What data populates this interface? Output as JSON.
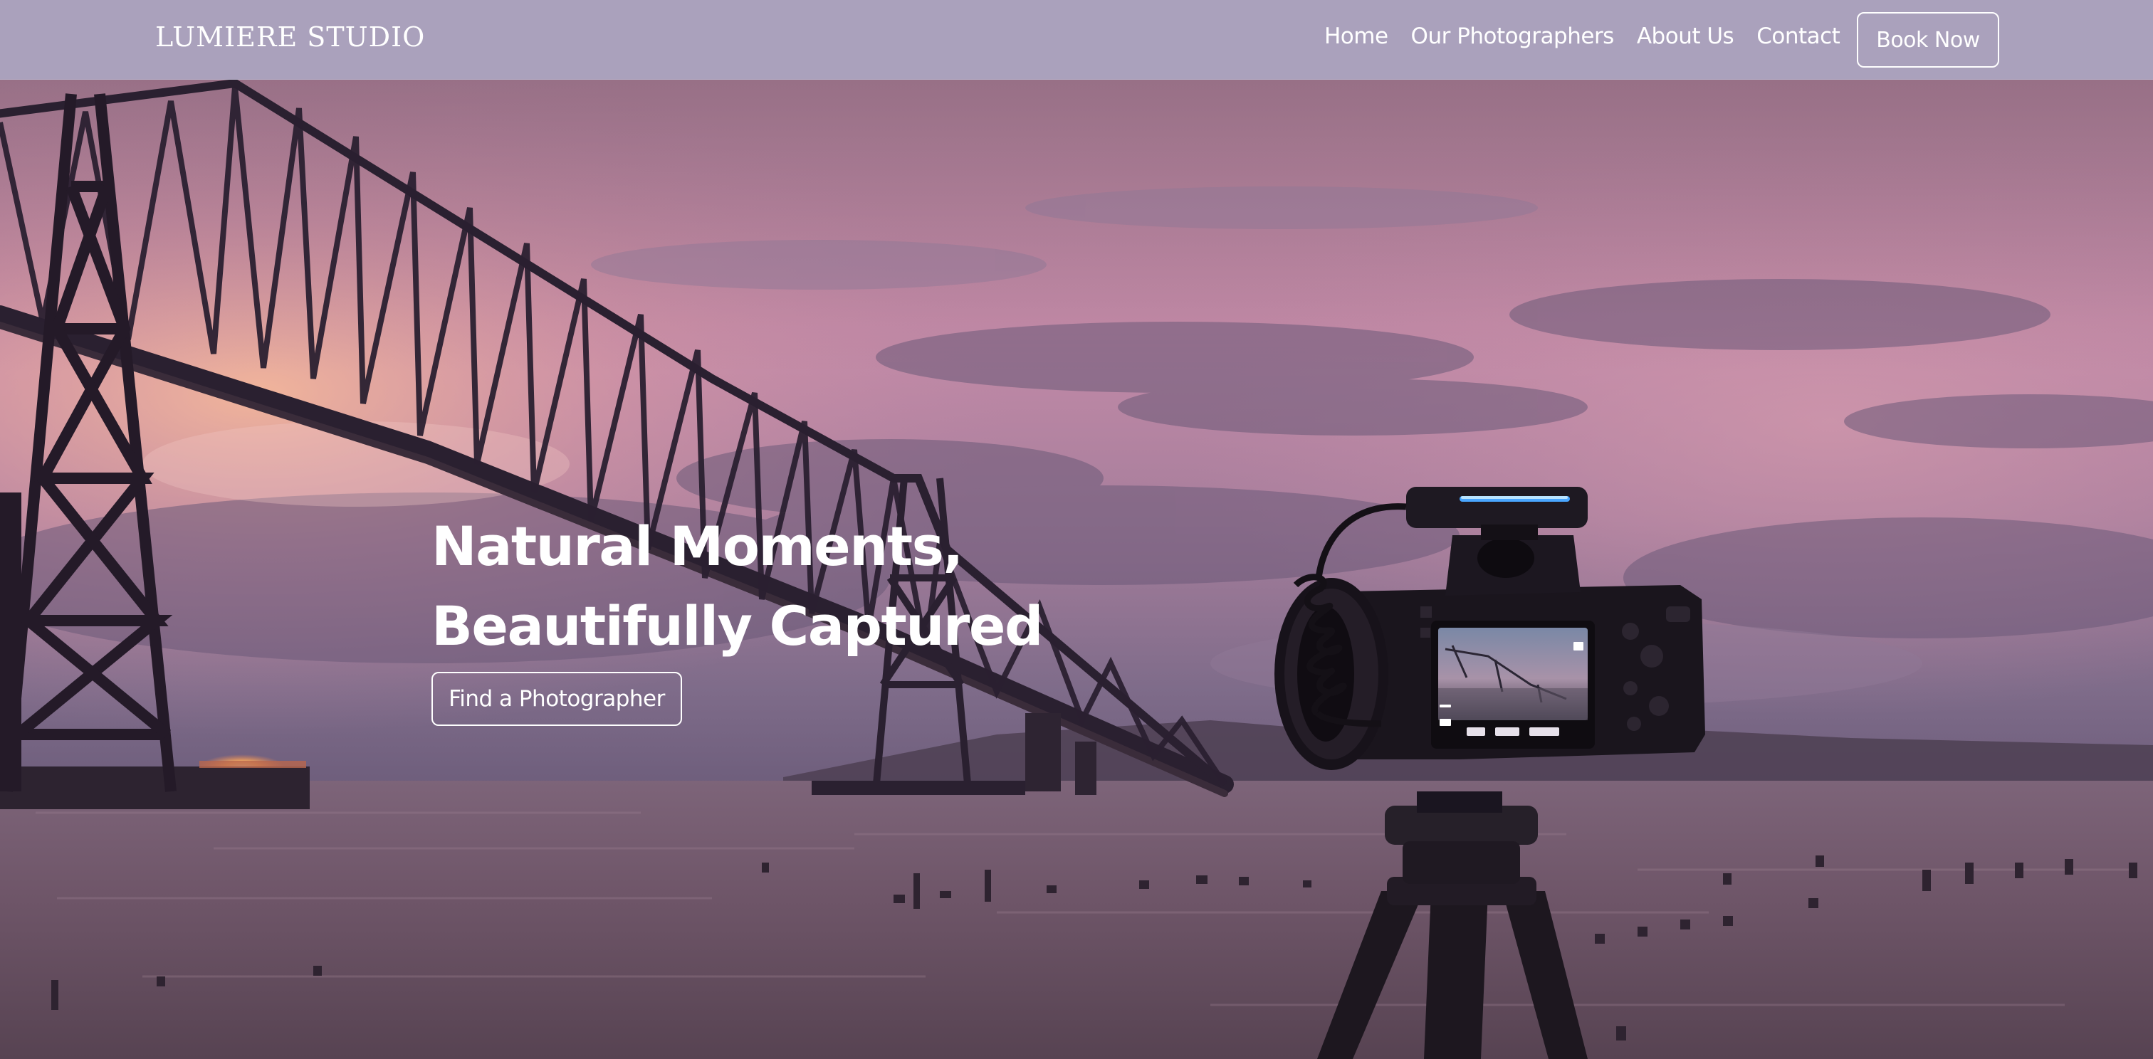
{
  "brand": {
    "name": "LUMIERE STUDIO"
  },
  "nav": {
    "links": [
      {
        "label": "Home"
      },
      {
        "label": "Our Photographers"
      },
      {
        "label": "About Us"
      },
      {
        "label": "Contact"
      }
    ],
    "cta_label": "Book Now"
  },
  "hero": {
    "title_line1": "Natural Moments,",
    "title_line2": "Beautifully Captured",
    "cta_label": "Find a Photographer",
    "background_image": "photo-camera-on-tripod-bridge-sunset"
  },
  "colors": {
    "navbar": "#aaa1bc",
    "text": "#ffffff",
    "sky_pink": "#c68aa8",
    "sky_purple": "#8a7a9c",
    "water": "#6e5568"
  }
}
